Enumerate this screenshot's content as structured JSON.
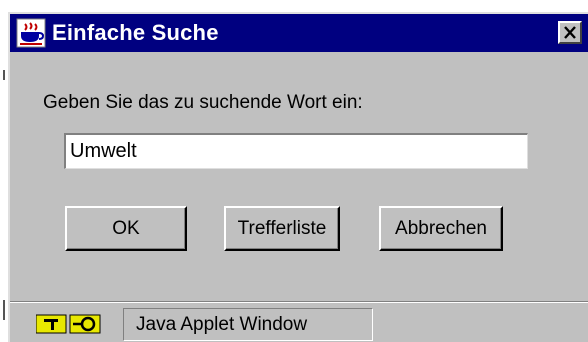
{
  "window": {
    "title": "Einfache Suche",
    "icon": "java-coffee-cup-icon",
    "close_icon": "close-icon"
  },
  "dialog": {
    "prompt": "Geben Sie das zu suchende Wort ein:",
    "search_value": "Umwelt"
  },
  "buttons": {
    "ok": "OK",
    "hit_list": "Trefferliste",
    "cancel": "Abbrechen"
  },
  "status_bar": {
    "icon": "java-applet-key-icon",
    "text": "Java Applet Window"
  },
  "colors": {
    "titlebar": "#000080",
    "face": "#c0c0c0"
  }
}
